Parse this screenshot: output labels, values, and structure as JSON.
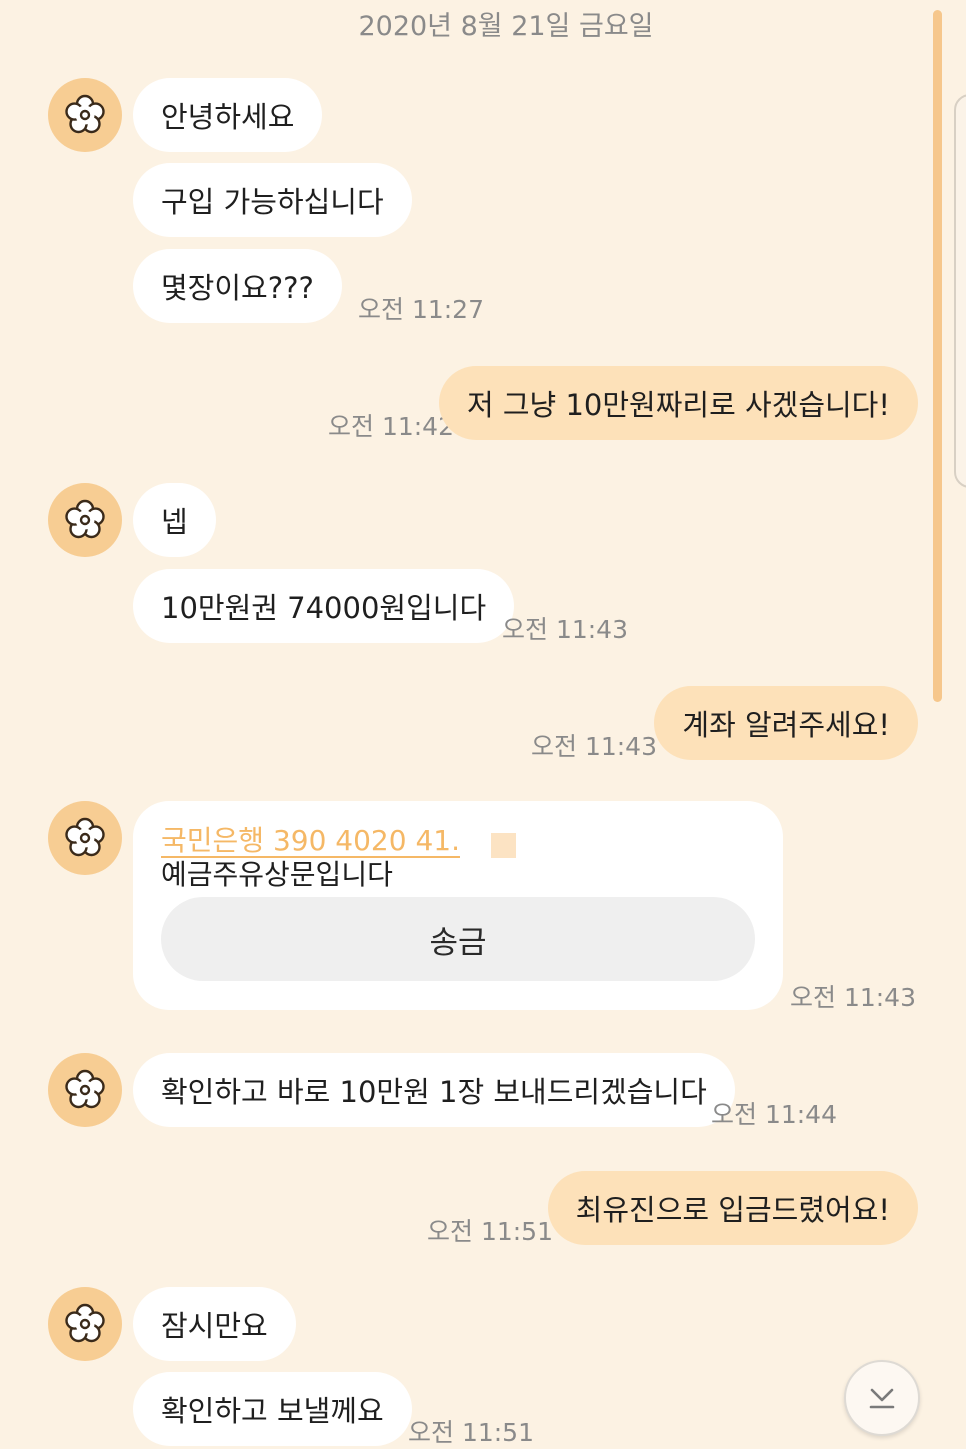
{
  "date_header": "2020년 8월 21일 금요일",
  "avatar_icon": "flower-icon",
  "colors": {
    "background": "#fcf2e3",
    "outgoing_bubble": "#fde1b9",
    "incoming_bubble": "#ffffff",
    "accent": "#f7cd93",
    "link": "#f5b866"
  },
  "messages": {
    "m1": "안녕하세요",
    "m2": "구입 가능하십니다",
    "m3": "몇장이요???",
    "t3": "오전 11:27",
    "m4": "저 그냥 10만원짜리로 사겠습니다!",
    "t4": "오전 11:42",
    "m5": "넵",
    "m6": "10만원권 74000원입니다",
    "t6": "오전 11:43",
    "m7": "계좌 알려주세요!",
    "t7": "오전 11:43",
    "card": {
      "account_link": "국민은행 390 4020 41.",
      "account_holder": "예금주유상문입니다",
      "transfer_button": "송금",
      "time": "오전 11:43"
    },
    "m9": "확인하고 바로 10만원 1장 보내드리겠습니다",
    "t9": "오전 11:44",
    "m10": "최유진으로 입금드렸어요!",
    "t10": "오전 11:51",
    "m11": "잠시만요",
    "m12": "확인하고 보낼께요",
    "t12": "오전 11:51"
  },
  "scroll_down_icon": "chevron-down-icon"
}
